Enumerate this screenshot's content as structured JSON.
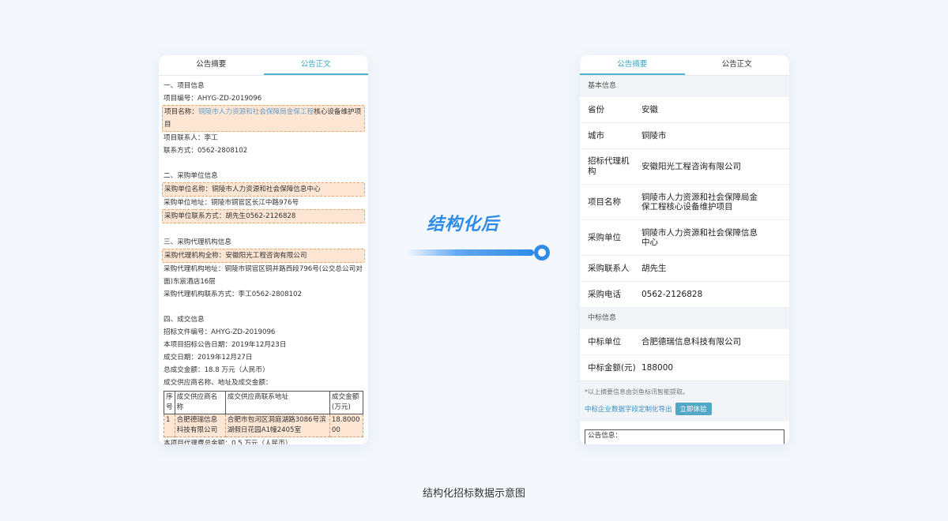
{
  "left": {
    "tabs": [
      "公告摘要",
      "公告正文"
    ],
    "s1": {
      "title": "一、项目信息",
      "code": "项目编号：AHYG-ZD-2019096",
      "name_prefix": "项目名称：",
      "name_link": "铜陵市人力资源和社会保障局金保工程",
      "name_rest": "核心设备维护项目",
      "contact": "项目联系人：李工",
      "phone": "联系方式：0562-2808102"
    },
    "s2": {
      "title": "二、采购单位信息",
      "name": "采购单位名称：铜陵市人力资源和社会保障信息中心",
      "addr": "采购单位地址：铜陵市铜官区长江中路976号",
      "contact": "采购单位联系方式：胡先生0562-2126828"
    },
    "s3": {
      "title": "三、采购代理机构信息",
      "name": "采购代理机构全称：安徽阳光工程咨询有限公司",
      "addr": "采购代理机构地址：铜陵市铜官区铜井路西段796号(公交总公司对面)东宸酒店16层",
      "contact": "采购代理机构联系方式：李工0562-2808102"
    },
    "s4": {
      "title": "四、成交信息",
      "doc_code": "招标文件编号：AHYG-ZD-2019096",
      "notice_date": "本项目招标公告日期：2019年12月23日",
      "deal_date": "成交日期：2019年12月27日",
      "total": "总成交金额：18.8 万元（人民币）",
      "list_title": "成交供应商名称、地址及成交金额：",
      "table_header": [
        "序号",
        "成交供应商名称",
        "成交供应商联系地址",
        "成交金额(万元)"
      ],
      "table_rows": [
        [
          "1",
          "合肥德瑞信息科技有限公司",
          "合肥市包河区洞庭湖路3086号滨湖假日花园A1幢2405室",
          "18.800000"
        ]
      ],
      "fee": "本项目代理费总金额：0.5 万元（人民币）"
    }
  },
  "middle": {
    "label": "结构化后"
  },
  "right": {
    "tabs": [
      "公告摘要",
      "公告正文"
    ],
    "basic_title": "基本信息",
    "basic_rows": [
      {
        "k": "省份",
        "v": "安徽"
      },
      {
        "k": "城市",
        "v": "铜陵市"
      },
      {
        "k": "招标代理机构",
        "v": "安徽阳光工程咨询有限公司"
      },
      {
        "k": "项目名称",
        "v": "铜陵市人力资源和社会保障局金保工程核心设备维护项目"
      },
      {
        "k": "采购单位",
        "v": "铜陵市人力资源和社会保障信息中心"
      },
      {
        "k": "采购联系人",
        "v": "胡先生"
      },
      {
        "k": "采购电话",
        "v": "0562-2126828"
      }
    ],
    "win_title": "中标信息",
    "win_rows": [
      {
        "k": "中标单位",
        "v": "合肥德瑞信息科技有限公司"
      },
      {
        "k": "中标金额(元)",
        "v": "188000"
      }
    ],
    "note": "*以上摘要信息由剑鱼标讯智能提取。",
    "export_text": "中标企业数据字段定制化导出",
    "try_button": "立即体验",
    "announcement_label": "公告信息："
  },
  "caption": "结构化招标数据示意图",
  "colors": {
    "accent": "#2f8be6",
    "tab_active": "#3ba8c8",
    "highlight_bg": "#fde6d4",
    "highlight_border": "#f0a46d"
  }
}
